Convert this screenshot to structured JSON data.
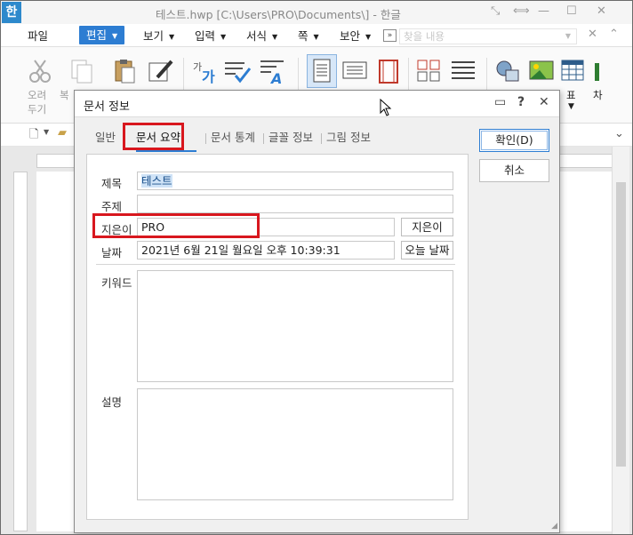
{
  "window": {
    "title": "테스트.hwp [C:\\Users\\PRO\\Documents\\] - 한글",
    "app_logo": "한"
  },
  "menu": {
    "items": [
      "파일",
      "편집",
      "보기",
      "입력",
      "서식",
      "쪽",
      "보안"
    ],
    "active": "편집",
    "more": "»",
    "search_placeholder": "찾을 내용"
  },
  "ribbon": {
    "cut_label_1": "오려",
    "cut_label_2": "두기",
    "copy_label": "복",
    "table_label": "표",
    "chart_label": "차"
  },
  "dialog": {
    "title": "문서 정보",
    "tabs": [
      "일반",
      "문서 요약",
      "문서 통계",
      "글꼴 정보",
      "그림 정보"
    ],
    "active_tab": "문서 요약",
    "ok_label": "확인(D)",
    "cancel_label": "취소",
    "fields": {
      "title_label": "제목",
      "title_value": "테스트",
      "subject_label": "주제",
      "subject_value": "",
      "author_label": "지은이",
      "author_value": "PRO",
      "author_button": "지은이",
      "date_label": "날짜",
      "date_value": "2021년 6월 21일 월요일 오후 10:39:31",
      "date_button": "오늘 날짜",
      "keywords_label": "키워드",
      "description_label": "설명"
    }
  },
  "colors": {
    "accent": "#2d7dd2",
    "highlight": "#d8171e",
    "logo": "#2d89cc"
  }
}
